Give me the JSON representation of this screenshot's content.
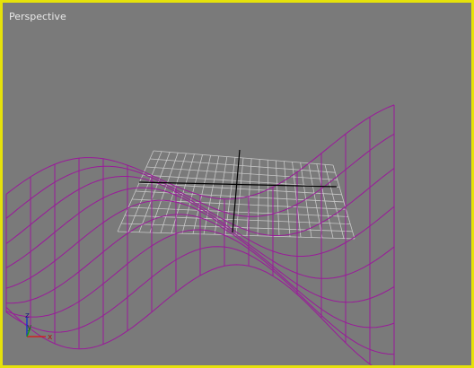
{
  "viewport": {
    "label": "Perspective",
    "border_color": "#e6e20a",
    "background": "#7a7a7a",
    "active": true
  },
  "axis_gizmo": {
    "x_label": "x",
    "y_label": "y",
    "z_label": "z",
    "x_color": "#e01010",
    "y_color": "#10a010",
    "z_color": "#1030d0"
  },
  "scene": {
    "wave_mesh_color": "#9a1a9a",
    "home_grid_color": "#c8c8c8",
    "world_axis_color": "#000000"
  }
}
